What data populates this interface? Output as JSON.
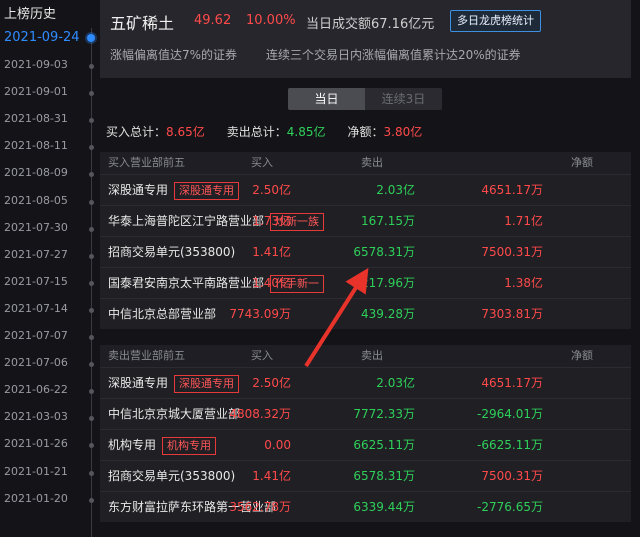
{
  "timeline": {
    "title": "上榜历史",
    "dates": [
      {
        "label": "2021-09-24",
        "active": true
      },
      {
        "label": "2021-09-03"
      },
      {
        "label": "2021-09-01"
      },
      {
        "label": "2021-08-31"
      },
      {
        "label": "2021-08-11"
      },
      {
        "label": "2021-08-09"
      },
      {
        "label": "2021-08-05"
      },
      {
        "label": "2021-07-30"
      },
      {
        "label": "2021-07-27"
      },
      {
        "label": "2021-07-15"
      },
      {
        "label": "2021-07-14"
      },
      {
        "label": "2021-07-07"
      },
      {
        "label": "2021-07-06"
      },
      {
        "label": "2021-06-22"
      },
      {
        "label": "2021-03-03"
      },
      {
        "label": "2021-01-26"
      },
      {
        "label": "2021-01-21"
      },
      {
        "label": "2021-01-20"
      }
    ]
  },
  "header": {
    "stock_name": "五矿稀土",
    "price": "49.62",
    "change_pct": "10.00%",
    "turnover": "当日成交额67.16亿元",
    "multi_day_button": "多日龙虎榜统计",
    "reason1": "涨幅偏离值达7%的证券",
    "reason2": "连续三个交易日内涨幅偏离值累计达20%的证券"
  },
  "tabs": {
    "day": "当日",
    "three_days": "连续3日"
  },
  "totals": {
    "buy_label": "买入总计：",
    "buy_value": "8.65亿",
    "sell_label": "卖出总计：",
    "sell_value": "4.85亿",
    "net_label": "净额：",
    "net_value": "3.80亿"
  },
  "buy_table": {
    "columns": [
      "买入营业部前五",
      "买入",
      "卖出",
      "净额"
    ],
    "rows": [
      {
        "name": "深股通专用",
        "tag": "深股通专用",
        "buy": "2.50亿",
        "sell": "2.03亿",
        "net": "4651.17万"
      },
      {
        "name": "华泰上海普陀区江宁路营业部",
        "tag": "炒新一族",
        "buy": "1.73亿",
        "sell": "167.15万",
        "net": "1.71亿"
      },
      {
        "name": "招商交易单元(353800)",
        "tag": "",
        "buy": "1.41亿",
        "sell": "6578.31万",
        "net": "7500.31万"
      },
      {
        "name": "国泰君安南京太平南路营业部",
        "tag": "作手新一",
        "buy": "1.40亿",
        "sell": "217.96万",
        "net": "1.38亿"
      },
      {
        "name": "中信北京总部营业部",
        "tag": "",
        "buy": "7743.09万",
        "sell": "439.28万",
        "net": "7303.81万"
      }
    ]
  },
  "sell_table": {
    "columns": [
      "卖出营业部前五",
      "买入",
      "卖出",
      "净额"
    ],
    "rows": [
      {
        "name": "深股通专用",
        "tag": "深股通专用",
        "buy": "2.50亿",
        "sell": "2.03亿",
        "net": "4651.17万"
      },
      {
        "name": "中信北京京城大厦营业部",
        "tag": "",
        "buy": "4808.32万",
        "sell": "7772.33万",
        "net": "-2964.01万"
      },
      {
        "name": "机构专用",
        "tag": "机构专用",
        "buy": "0.00",
        "sell": "6625.11万",
        "net": "-6625.11万"
      },
      {
        "name": "招商交易单元(353800)",
        "tag": "",
        "buy": "1.41亿",
        "sell": "6578.31万",
        "net": "7500.31万"
      },
      {
        "name": "东方财富拉萨东环路第一营业部",
        "tag": "",
        "buy": "3562.78万",
        "sell": "6339.44万",
        "net": "-2776.65万"
      }
    ]
  },
  "colors": {
    "up": "#ff4a4a",
    "down": "#2fd05a",
    "accent": "#2f8cff",
    "annotation_arrow": "#e8332b"
  }
}
